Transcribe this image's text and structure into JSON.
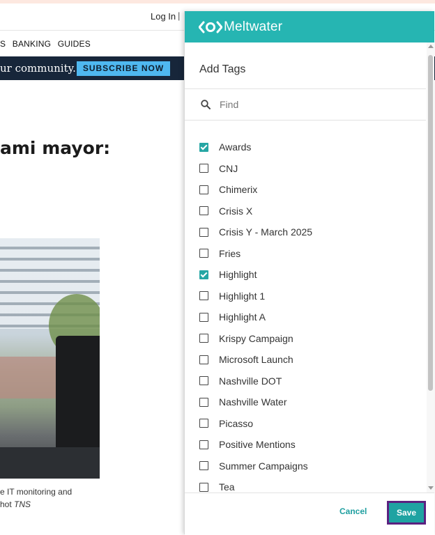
{
  "background_page": {
    "login_label": "Log In",
    "login_separator": "|",
    "nav_items": [
      "S",
      "BANKING",
      "GUIDES"
    ],
    "promo_text": "ur community.",
    "subscribe_label": "SUBSCRIBE NOW",
    "headline": "ami mayor:",
    "caption_line1": "e IT monitoring and",
    "caption_line2_prefix": "hot ",
    "caption_line2_credit": "TNS"
  },
  "panel": {
    "brand": "Meltwater",
    "brand_color": "#26b5b2",
    "title": "Add Tags",
    "search": {
      "placeholder": "Find",
      "value": ""
    },
    "tags": [
      {
        "label": "Awards",
        "checked": true
      },
      {
        "label": "CNJ",
        "checked": false
      },
      {
        "label": "Chimerix",
        "checked": false
      },
      {
        "label": "Crisis X",
        "checked": false
      },
      {
        "label": "Crisis Y - March 2025",
        "checked": false
      },
      {
        "label": "Fries",
        "checked": false
      },
      {
        "label": "Highlight",
        "checked": true
      },
      {
        "label": "Highlight 1",
        "checked": false
      },
      {
        "label": "Highlight A",
        "checked": false
      },
      {
        "label": "Krispy Campaign",
        "checked": false
      },
      {
        "label": "Microsoft Launch",
        "checked": false
      },
      {
        "label": "Nashville DOT",
        "checked": false
      },
      {
        "label": "Nashville Water",
        "checked": false
      },
      {
        "label": "Picasso",
        "checked": false
      },
      {
        "label": "Positive Mentions",
        "checked": false
      },
      {
        "label": "Summer Campaigns",
        "checked": false
      },
      {
        "label": "Tea",
        "checked": false
      }
    ],
    "footer": {
      "cancel_label": "Cancel",
      "save_label": "Save",
      "save_focus_color": "#5b2180"
    }
  }
}
